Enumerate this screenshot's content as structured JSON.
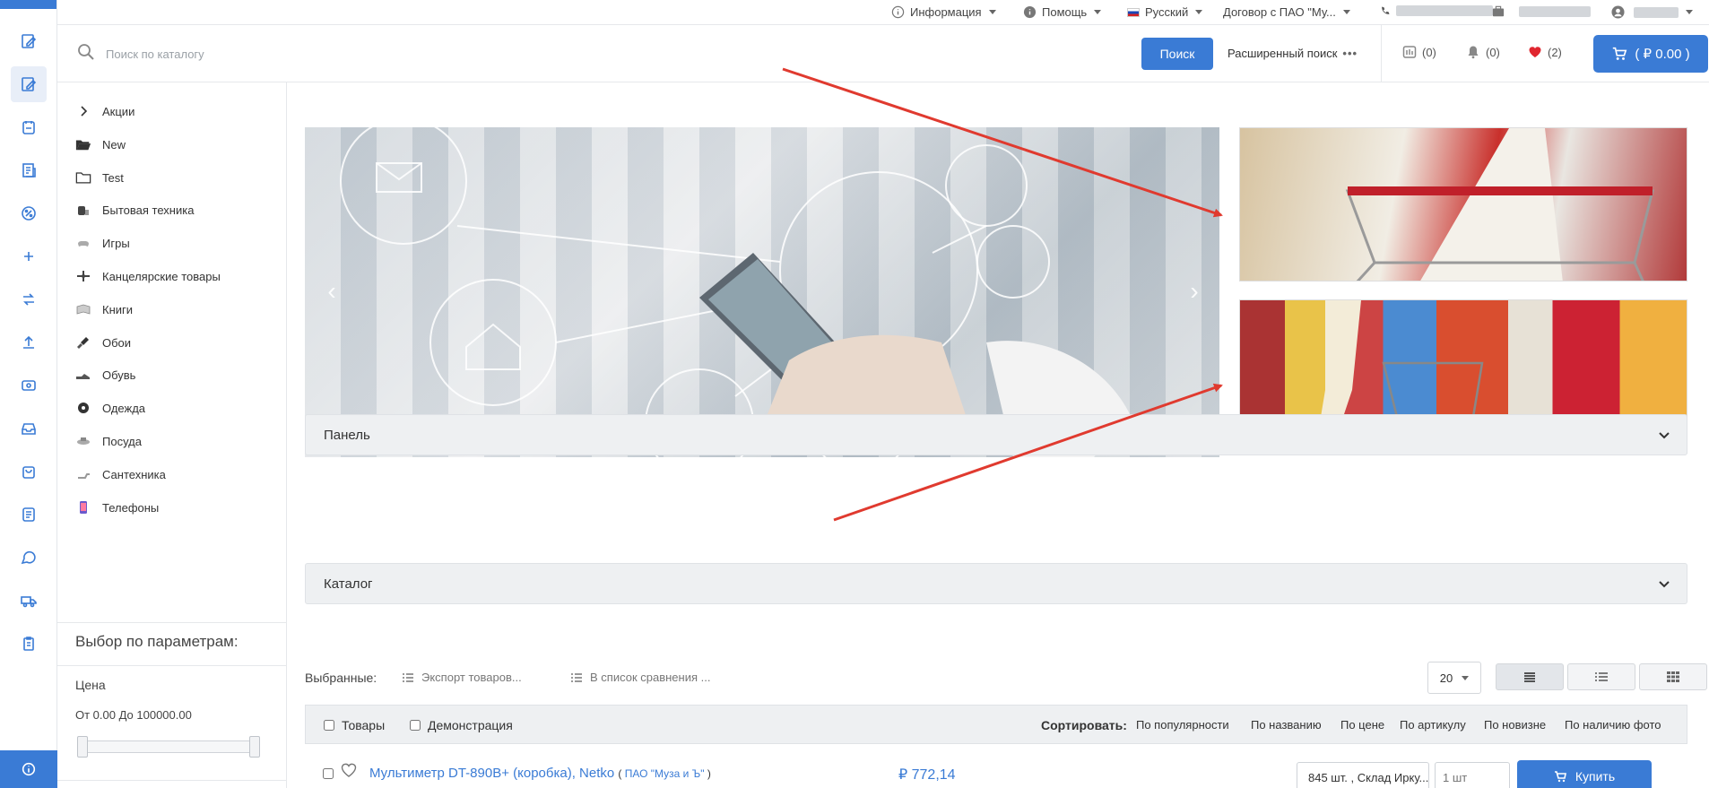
{
  "topbar": {
    "info": "Информация",
    "help": "Помощь",
    "language": "Русский",
    "contract": "Договор с ПАО \"Му..."
  },
  "search": {
    "placeholder": "Поиск по каталогу",
    "button": "Поиск",
    "advanced": "Расширенный поиск"
  },
  "counters": {
    "compare": "(0)",
    "notifications": "(0)",
    "favorites": "(2)",
    "cart": "( ₽ 0.00 )"
  },
  "categories": [
    {
      "label": "Акции",
      "icon": "chevron-right-icon"
    },
    {
      "label": "New",
      "icon": "folder-open-icon"
    },
    {
      "label": "Test",
      "icon": "folder-icon"
    },
    {
      "label": "Бытовая техника",
      "icon": "appliance-icon"
    },
    {
      "label": "Игры",
      "icon": "gamepad-icon"
    },
    {
      "label": "Канцелярские товары",
      "icon": "stationery-icon"
    },
    {
      "label": "Книги",
      "icon": "book-icon"
    },
    {
      "label": "Обои",
      "icon": "brush-icon"
    },
    {
      "label": "Обувь",
      "icon": "shoe-icon"
    },
    {
      "label": "Одежда",
      "icon": "clothes-icon"
    },
    {
      "label": "Посуда",
      "icon": "dishes-icon"
    },
    {
      "label": "Сантехника",
      "icon": "plumbing-icon"
    },
    {
      "label": "Телефоны",
      "icon": "phone-icon"
    }
  ],
  "filters": {
    "title": "Выбор по параметрам:",
    "price_label": "Цена",
    "price_range": "От 0.00 До 100000.00",
    "price_min": 0,
    "price_max": 100000
  },
  "panels": {
    "panel": "Панель",
    "catalog": "Каталог"
  },
  "toolbar": {
    "selected": "Выбранные:",
    "export": "Экспорт товаров...",
    "compare": "В список сравнения ...",
    "per_page": "20"
  },
  "sortbar": {
    "goods": "Товары",
    "demo": "Демонстрация",
    "sort_label": "Сортировать:",
    "options": [
      "По популярности",
      "По названию",
      "По цене",
      "По артикулу",
      "По новизне",
      "По наличию фото"
    ]
  },
  "product": {
    "name": "Мультиметр DT-890B+ (коробка), Netko",
    "vendor_prefix": "(",
    "vendor": "ПАО \"Муза и Ъ\"",
    "vendor_suffix": ")",
    "price": "₽ 772,14",
    "stock": "845 шт. , Склад Ирку...",
    "qty_placeholder": "1 шт",
    "buy": "Купить"
  },
  "colors": {
    "accent": "#3a7bd5",
    "annotation": "#e03a2f",
    "favorite": "#e0262f"
  }
}
